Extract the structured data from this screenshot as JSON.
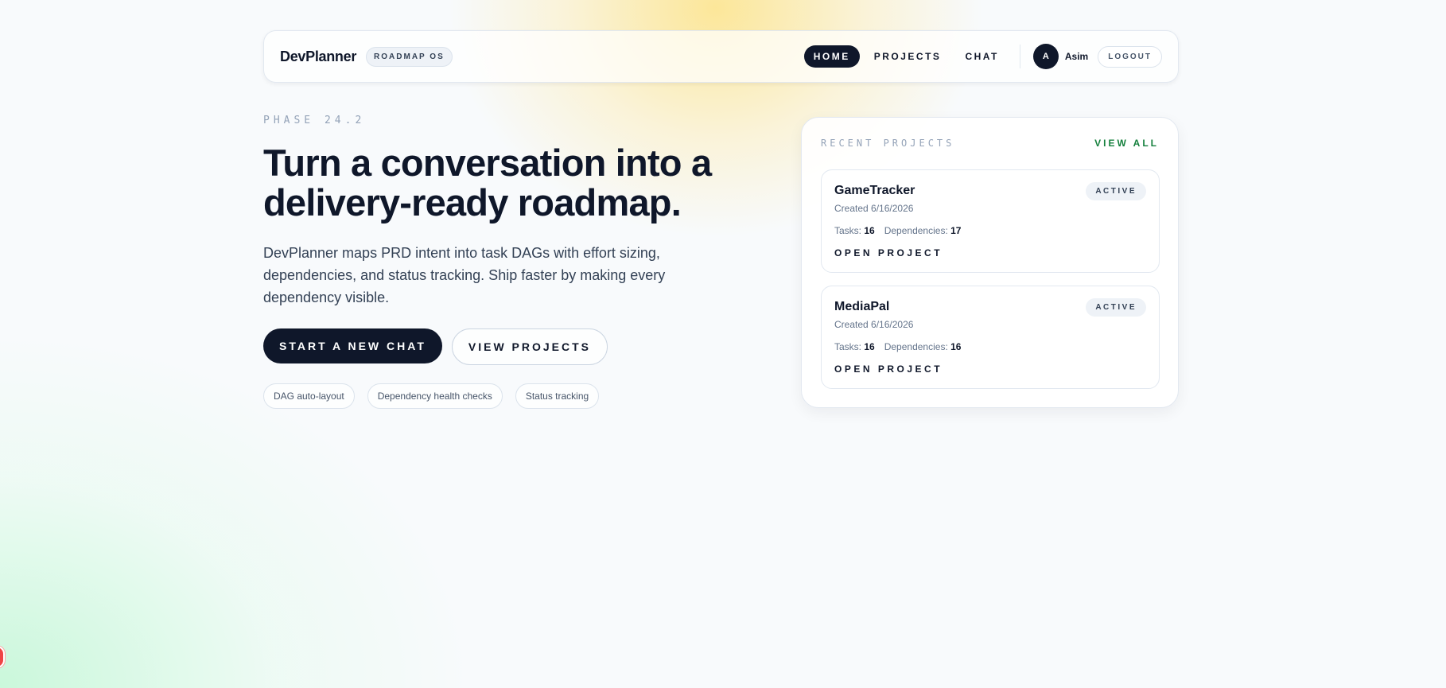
{
  "nav": {
    "brand": "DevPlanner",
    "badge": "ROADMAP OS",
    "links": [
      {
        "label": "HOME",
        "active": true
      },
      {
        "label": "PROJECTS",
        "active": false
      },
      {
        "label": "CHAT",
        "active": false
      }
    ],
    "user": {
      "initial": "A",
      "name": "Asim"
    },
    "logout_label": "LOGOUT"
  },
  "hero": {
    "eyebrow": "PHASE 24.2",
    "title": "Turn a conversation into a delivery-ready roadmap.",
    "description": "DevPlanner maps PRD intent into task DAGs with effort sizing, dependencies, and status tracking. Ship faster by making every dependency visible.",
    "primary_cta": "START A NEW CHAT",
    "secondary_cta": "VIEW PROJECTS",
    "chips": [
      "DAG auto-layout",
      "Dependency health checks",
      "Status tracking"
    ]
  },
  "recent_projects": {
    "title": "RECENT PROJECTS",
    "view_all_label": "VIEW ALL",
    "projects": [
      {
        "name": "GameTracker",
        "status": "ACTIVE",
        "created": "Created 6/16/2026",
        "tasks_label": "Tasks:",
        "tasks": "16",
        "deps_label": "Dependencies:",
        "dependencies": "17",
        "open_label": "OPEN PROJECT"
      },
      {
        "name": "MediaPal",
        "status": "ACTIVE",
        "created": "Created 6/16/2026",
        "tasks_label": "Tasks:",
        "tasks": "16",
        "deps_label": "Dependencies:",
        "dependencies": "16",
        "open_label": "OPEN PROJECT"
      }
    ]
  },
  "colors": {
    "primary": "#0f172a",
    "accent_green": "#15803d",
    "glow_yellow": "#fde078",
    "glow_green": "#bbf7d0"
  }
}
